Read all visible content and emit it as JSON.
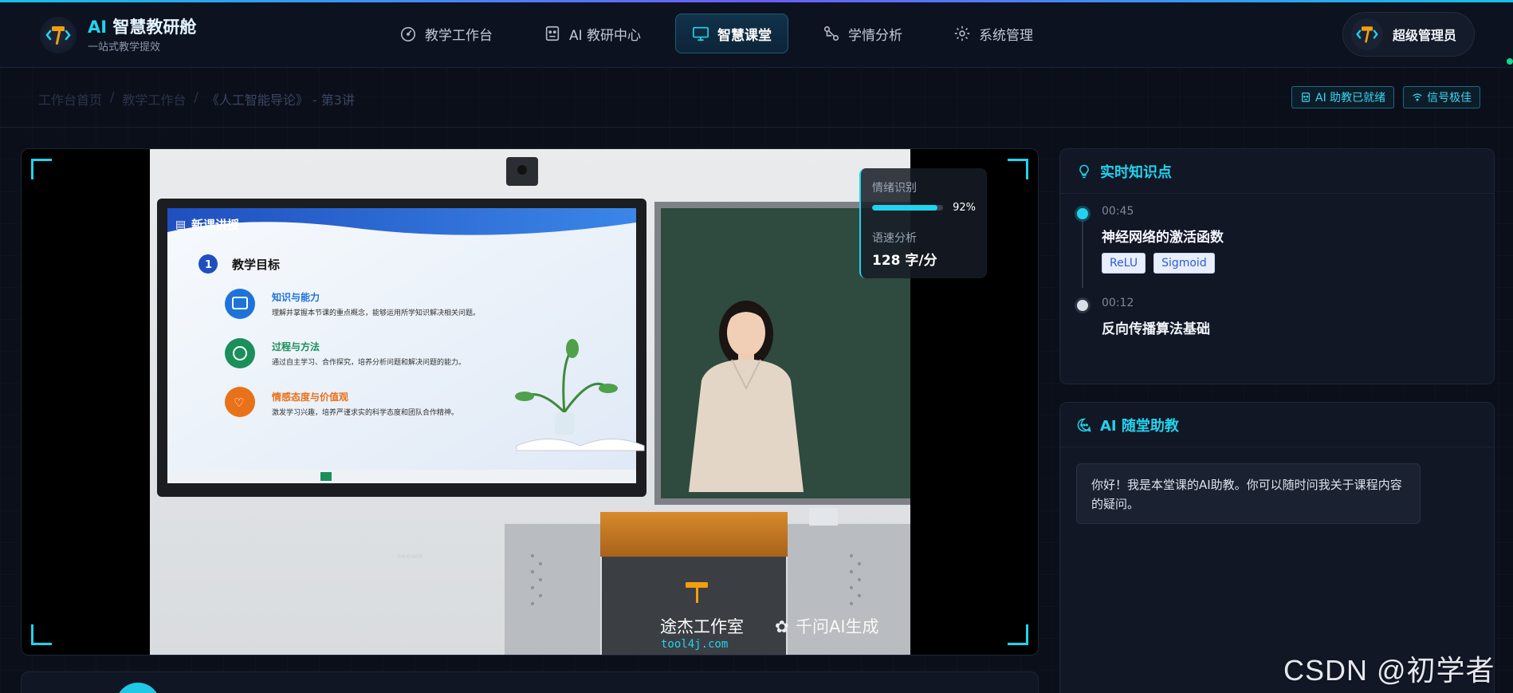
{
  "brand": {
    "title_prefix": "AI",
    "title": "智慧教研舱",
    "subtitle": "一站式教学提效"
  },
  "nav": {
    "items": [
      {
        "label": "教学工作台",
        "icon": "dashboard-icon",
        "active": false
      },
      {
        "label": "AI 教研中心",
        "icon": "robot-icon",
        "active": false
      },
      {
        "label": "智慧课堂",
        "icon": "monitor-icon",
        "active": true
      },
      {
        "label": "学情分析",
        "icon": "analytics-icon",
        "active": false
      },
      {
        "label": "系统管理",
        "icon": "gear-icon",
        "active": false
      }
    ]
  },
  "user": {
    "name": "超级管理员"
  },
  "breadcrumb": {
    "items": [
      "工作台首页",
      "教学工作台",
      "《人工智能导论》 - 第3讲"
    ]
  },
  "status": {
    "ai_assistant": "AI 助教已就绪",
    "signal": "信号极佳"
  },
  "video": {
    "slide_header": "新课讲授",
    "slide_goal_number": "1",
    "slide_goal_title": "教学目标",
    "slide_points": [
      {
        "title": "知识与能力",
        "text": "理解并掌握本节课的重点概念，能够运用所学知识解决相关问题。",
        "color": "#1e73d8"
      },
      {
        "title": "过程与方法",
        "text": "通过自主学习、合作探究，培养分析问题和解决问题的能力。",
        "color": "#1a8f5a"
      },
      {
        "title": "情感态度与价值观",
        "text": "激发学习兴趣，培养严谨求实的科学态度和团队合作精神。",
        "color": "#e8711a"
      }
    ],
    "tv_brand": "seewo",
    "studio_name": "途杰工作室",
    "studio_url": "tool4j.com",
    "ai_mark": "千问AI生成"
  },
  "overlay": {
    "emotion_label": "情绪识别",
    "emotion_value": "92%",
    "emotion_fraction": 0.92,
    "speed_label": "语速分析",
    "speed_value": "128 字/分"
  },
  "knowledge": {
    "title": "实时知识点",
    "items": [
      {
        "time": "00:45",
        "title": "神经网络的激活函数",
        "tags": [
          "ReLU",
          "Sigmoid"
        ]
      },
      {
        "time": "00:12",
        "title": "反向传播算法基础",
        "tags": []
      }
    ]
  },
  "assistant": {
    "title": "AI 随堂助教",
    "message": "你好！我是本堂课的AI助教。你可以随时问我关于课程内容的疑问。"
  },
  "watermark": "CSDN @初学者 ↑",
  "colors": {
    "accent": "#22d3ee",
    "background": "#0b0f1a",
    "panel": "#111725"
  }
}
